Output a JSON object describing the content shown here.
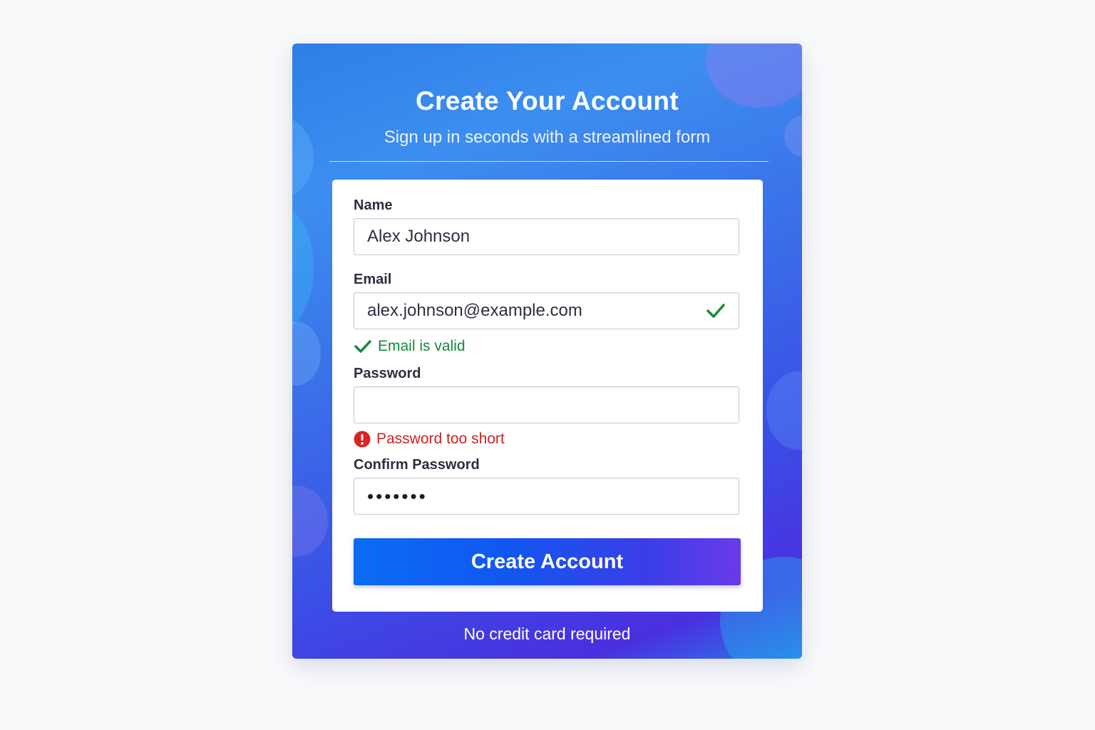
{
  "header": {
    "title": "Create Your Account",
    "subtitle": "Sign up in seconds with a streamlined form"
  },
  "form": {
    "name": {
      "label": "Name",
      "value": "Alex Johnson"
    },
    "email": {
      "label": "Email",
      "value": "alex.johnson@example.com",
      "validation_message": "Email is valid",
      "status": "valid"
    },
    "password": {
      "label": "Password",
      "value": "",
      "validation_message": "Password too short",
      "status": "error"
    },
    "confirm_password": {
      "label": "Confirm Password",
      "masked_value": "•••••••"
    },
    "submit_label": "Create Account"
  },
  "footer": {
    "note": "No credit card required"
  },
  "colors": {
    "success": "#168a3c",
    "error": "#cc2222",
    "button_start": "#0a6cf4",
    "button_end": "#6a3ae8"
  },
  "icons": {
    "email_status": "checkmark-icon",
    "email_message": "checkmark-icon",
    "password_message": "error-icon"
  }
}
